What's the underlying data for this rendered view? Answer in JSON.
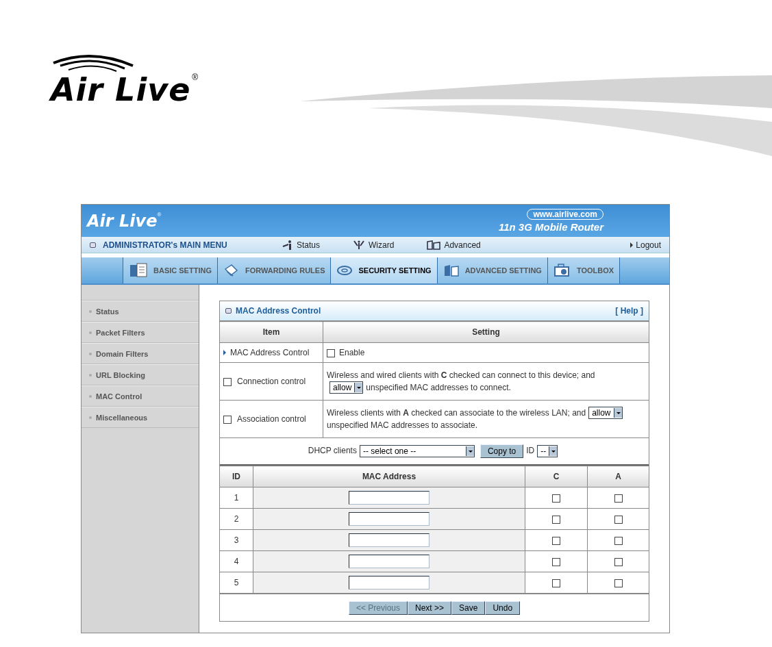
{
  "page_logo": {
    "text": "Air Live",
    "mark": "®"
  },
  "header": {
    "logo": "Air Live",
    "logo_mark": "®",
    "url": "www.airlive.com",
    "product": "11n 3G Mobile Router"
  },
  "main_menu": {
    "title": "ADMINISTRATOR's MAIN MENU",
    "links": [
      {
        "label": "Status",
        "kind": "status"
      },
      {
        "label": "Wizard",
        "kind": "wizard"
      },
      {
        "label": "Advanced",
        "kind": "advanced"
      }
    ],
    "logout": "Logout"
  },
  "tabs": [
    {
      "label": "BASIC SETTING",
      "kind": "basic",
      "selected": false
    },
    {
      "label": "FORWARDING RULES",
      "kind": "forwarding",
      "selected": false
    },
    {
      "label": "SECURITY SETTING",
      "kind": "security",
      "selected": true
    },
    {
      "label": "ADVANCED SETTING",
      "kind": "advanced",
      "selected": false
    },
    {
      "label": "TOOLBOX",
      "kind": "toolbox",
      "selected": false
    }
  ],
  "sidebar": {
    "items": [
      {
        "label": "Status"
      },
      {
        "label": "Packet Filters"
      },
      {
        "label": "Domain Filters"
      },
      {
        "label": "URL Blocking"
      },
      {
        "label": "MAC Control"
      },
      {
        "label": "Miscellaneous"
      }
    ]
  },
  "panel": {
    "title": "MAC Address Control",
    "help": "[ Help ]",
    "columns": [
      "Item",
      "Setting"
    ],
    "rows": [
      {
        "kind": "enable",
        "item": "MAC Address Control",
        "option": "Enable",
        "checked": false
      },
      {
        "kind": "control",
        "item": "Connection control",
        "checked": false,
        "before": "Wireless and wired clients with **C** checked can connect to this device; and",
        "select": "allow",
        "after": "unspecified MAC addresses to connect.",
        "select_inline": false
      },
      {
        "kind": "control",
        "item": "Association control",
        "checked": false,
        "before": "Wireless clients with **A** checked can associate to the wireless LAN; and",
        "select": "allow",
        "after": "unspecified MAC addresses to associate.",
        "select_inline": true
      }
    ],
    "dhcp": {
      "label": "DHCP clients",
      "select": "-- select one --",
      "button": "Copy to",
      "id_label": "ID",
      "id_select": "--"
    },
    "mac_table": {
      "columns": [
        "ID",
        "MAC Address",
        "C",
        "A"
      ],
      "rows": [
        {
          "id": "1",
          "c": false,
          "a": false
        },
        {
          "id": "2",
          "c": false,
          "a": false
        },
        {
          "id": "3",
          "c": false,
          "a": false
        },
        {
          "id": "4",
          "c": false,
          "a": false
        },
        {
          "id": "5",
          "c": false,
          "a": false
        }
      ]
    },
    "buttons": [
      {
        "label": "<< Previous",
        "disabled": true
      },
      {
        "label": "Next >>",
        "disabled": false
      },
      {
        "label": "Save",
        "disabled": false
      },
      {
        "label": "Undo",
        "disabled": false
      }
    ]
  }
}
